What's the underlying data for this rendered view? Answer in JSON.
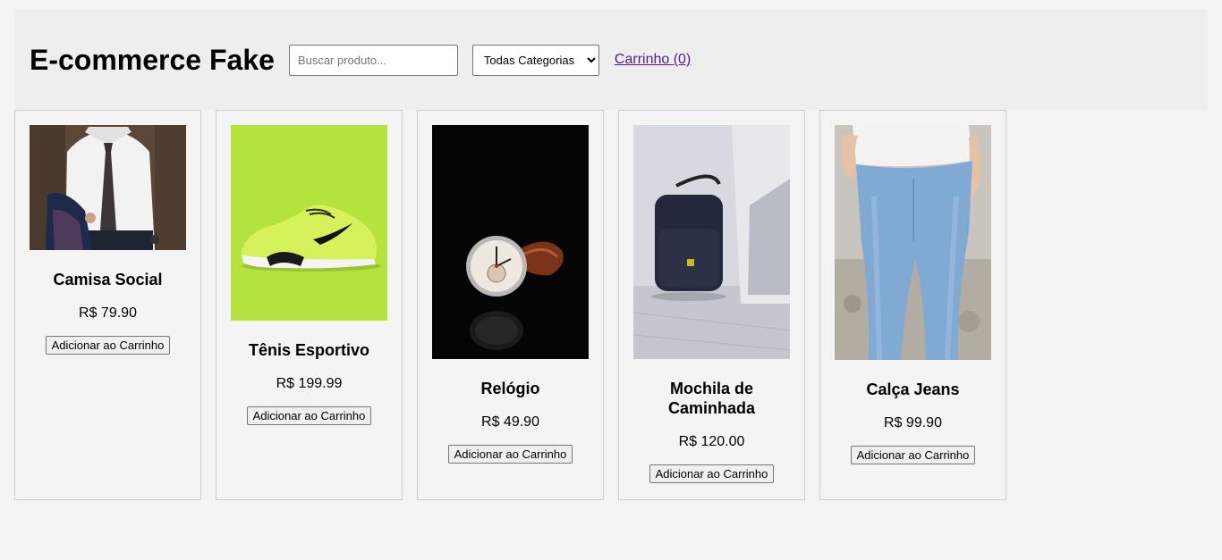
{
  "header": {
    "title": "E-commerce Fake",
    "search_placeholder": "Buscar produto...",
    "category_selected": "Todas Categorias",
    "cart_label": "Carrinho (0)"
  },
  "products": [
    {
      "name": "Camisa Social",
      "price": "R$ 79.90",
      "button": "Adicionar ao Carrinho",
      "image": "dress-shirt-photo"
    },
    {
      "name": "Tênis Esportivo",
      "price": "R$ 199.99",
      "button": "Adicionar ao Carrinho",
      "image": "sneaker-photo"
    },
    {
      "name": "Relógio",
      "price": "R$ 49.90",
      "button": "Adicionar ao Carrinho",
      "image": "wristwatch-photo"
    },
    {
      "name": "Mochila de Caminhada",
      "price": "R$ 120.00",
      "button": "Adicionar ao Carrinho",
      "image": "backpack-photo"
    },
    {
      "name": "Calça Jeans",
      "price": "R$ 99.90",
      "button": "Adicionar ao Carrinho",
      "image": "jeans-photo"
    }
  ],
  "colors": {
    "page_background": "#f4f4f4",
    "header_background": "#eeeeee",
    "link_visited": "#551a8b",
    "card_border": "#cccccc"
  }
}
